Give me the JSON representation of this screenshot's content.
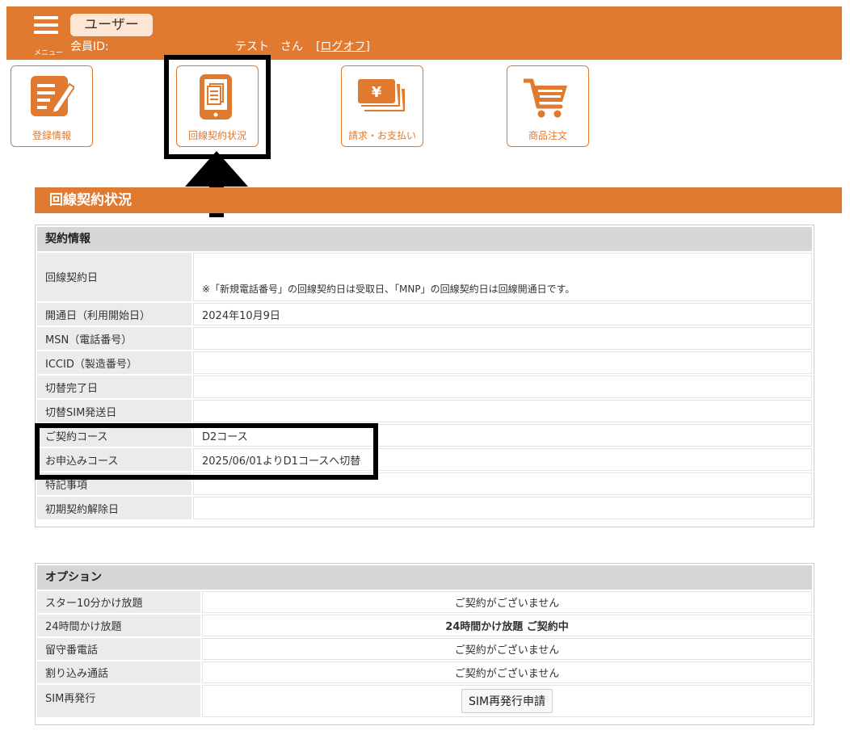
{
  "header": {
    "menu_label": "メニュー",
    "user_badge": "ユーザー",
    "member_id_label": "会員ID:",
    "user_name": "テスト　さん",
    "logout": "[ログオフ]"
  },
  "tiles": [
    {
      "label": "登録情報",
      "icon": "registration-icon"
    },
    {
      "label": "回線契約状況",
      "icon": "contract-tablet-icon"
    },
    {
      "label": "請求・お支払い",
      "icon": "yen-bill-icon"
    },
    {
      "label": "商品注文",
      "icon": "shopping-cart-icon"
    }
  ],
  "section_title": "回線契約状況",
  "contract": {
    "heading": "契約情報",
    "rows": [
      {
        "label": "回線契約日",
        "value": "※「新規電話番号」の回線契約日は受取日、「MNP」の回線契約日は回線開通日です。"
      },
      {
        "label": "開通日（利用開始日）",
        "value": "2024年10月9日"
      },
      {
        "label": "MSN（電話番号）",
        "value": ""
      },
      {
        "label": "ICCID（製造番号）",
        "value": ""
      },
      {
        "label": "切替完了日",
        "value": ""
      },
      {
        "label": "切替SIM発送日",
        "value": ""
      },
      {
        "label": "ご契約コース",
        "value": "D2コース"
      },
      {
        "label": "お申込みコース",
        "value": "2025/06/01よりD1コースへ切替"
      },
      {
        "label": "特記事項",
        "value": ""
      },
      {
        "label": "初期契約解除日",
        "value": ""
      }
    ]
  },
  "options": {
    "heading": "オプション",
    "rows": [
      {
        "label": "スター10分かけ放題",
        "value": "ご契約がございません"
      },
      {
        "label": "24時間かけ放題",
        "value": "24時間かけ放題 ご契約中"
      },
      {
        "label": "留守番電話",
        "value": "ご契約がございません"
      },
      {
        "label": "割り込み通話",
        "value": "ご契約がございません"
      },
      {
        "label": "SIM再発行",
        "button": "SIM再発行申請"
      }
    ]
  },
  "colors": {
    "brand": "#e07a30",
    "active_option": "#e53a2e",
    "annotation": "#000000"
  }
}
